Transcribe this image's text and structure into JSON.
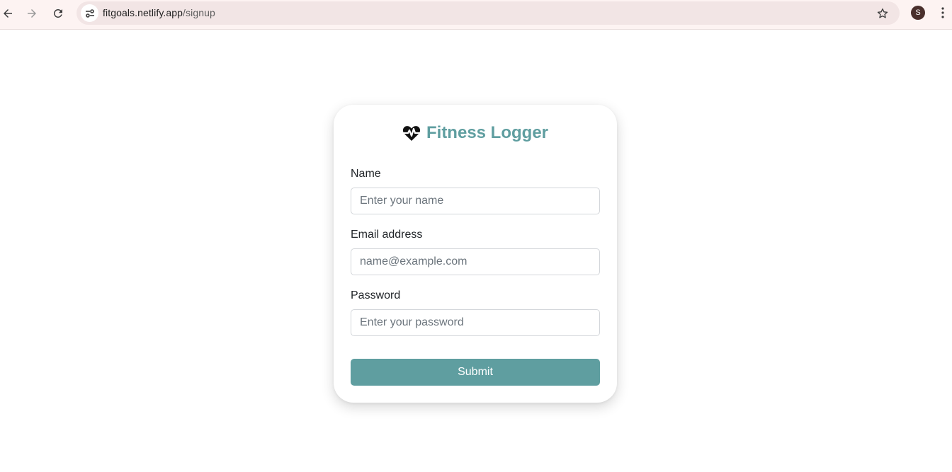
{
  "browser": {
    "url_host": "fitgoals.netlify.app",
    "url_path": "/signup",
    "profile_initial": "S",
    "icons": [
      "back-arrow-icon",
      "forward-arrow-icon",
      "reload-icon",
      "site-info-icon",
      "star-icon",
      "kebab-menu-icon"
    ]
  },
  "app": {
    "title": "Fitness Logger",
    "logo_icon": "heart-pulse-icon",
    "accent_color": "#5f9ea0"
  },
  "form": {
    "name_label": "Name",
    "name_placeholder": "Enter your name",
    "email_label": "Email address",
    "email_placeholder": "name@example.com",
    "password_label": "Password",
    "password_placeholder": "Enter your password",
    "submit_label": "Submit"
  }
}
